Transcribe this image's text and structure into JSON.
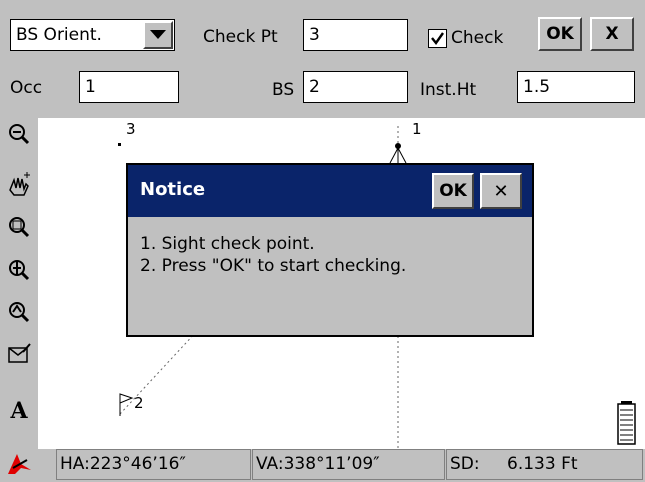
{
  "toolbar": {
    "mode_select": "BS Orient.",
    "check_pt_label": "Check Pt",
    "check_pt_value": "3",
    "check_label": "Check",
    "check_checked": true,
    "ok_label": "OK",
    "close_label": "X",
    "occ_label": "Occ",
    "occ_value": "1",
    "bs_label": "BS",
    "bs_value": "2",
    "inst_ht_label": "Inst.Ht",
    "inst_ht_value": "1.5"
  },
  "map": {
    "points": [
      {
        "label": "3",
        "kind": "point"
      },
      {
        "label": "1",
        "kind": "instrument"
      },
      {
        "label": "2",
        "kind": "flag"
      }
    ]
  },
  "tools": [
    "zoom-out-icon",
    "pan-hand-icon",
    "zoom-window-icon",
    "zoom-in-icon",
    "zoom-extents-icon",
    "layer-check-icon",
    "text-size-icon",
    "survey-red-icon"
  ],
  "dialog": {
    "title": "Notice",
    "ok_label": "OK",
    "close_label": "✕",
    "lines": [
      "1. Sight check point.",
      "2. Press \"OK\" to start checking."
    ]
  },
  "status": {
    "ha": "HA:223°46’16″",
    "va": "VA:338°11’09″",
    "sd_label": "SD:",
    "sd_value": "6.133 Ft"
  },
  "colors": {
    "dialog_title_bg": "#0a246a",
    "panel": "#c0c0c0"
  }
}
